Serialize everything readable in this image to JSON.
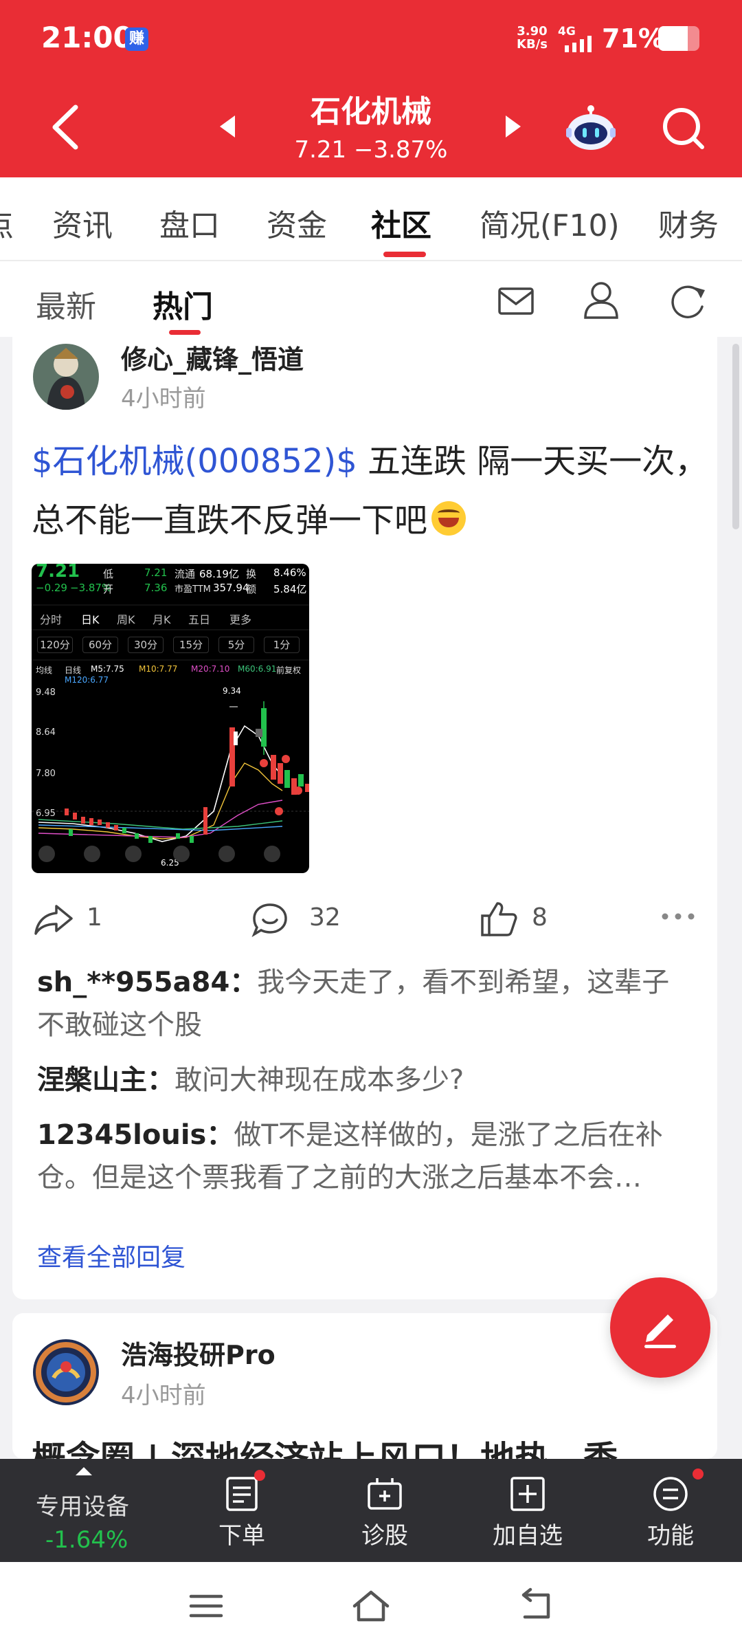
{
  "status": {
    "time": "21:00",
    "app_badge": "赚",
    "net_speed": "3.90",
    "net_unit": "KB/s",
    "network": "4G",
    "battery": "71%",
    "battery_level": 0.71
  },
  "header": {
    "stock_name": "石化机械",
    "quote": "7.21 −3.87%"
  },
  "tabs": [
    {
      "label": "点"
    },
    {
      "label": "资讯"
    },
    {
      "label": "盘口"
    },
    {
      "label": "资金"
    },
    {
      "label": "社区"
    },
    {
      "label": "简况(F10)"
    },
    {
      "label": "财务"
    }
  ],
  "active_tab": "社区",
  "subtabs": [
    {
      "label": "最新"
    },
    {
      "label": "热门"
    }
  ],
  "active_subtab": "热门",
  "post1": {
    "username": "修心_藏锋_悟道",
    "time": "4小时前",
    "stock_tag": "$石化机械(000852)$",
    "text": " 五连跌 隔一天买一次，总不能一直跌不反弹一下吧",
    "emoji": "joy-emoji",
    "thumbnail": {
      "price": "7.21",
      "change": "−0.29",
      "change_pct": "−3.87%",
      "low_label": "低",
      "low_value": "7.21",
      "open_label": "开",
      "open_value": "7.36",
      "float_label": "流通",
      "float_value": "68.19亿",
      "pe_label": "市盈TTM",
      "pe_value": "357.94",
      "turnover_label": "换",
      "turnover_value": "8.46%",
      "amount_label": "额",
      "amount_value": "5.84亿",
      "periods": [
        "分时",
        "日K",
        "周K",
        "月K",
        "五日",
        "更多"
      ],
      "minute_periods": [
        "120分",
        "60分",
        "30分",
        "15分",
        "5分",
        "1分"
      ],
      "ma_type": "均线",
      "ma_labels": [
        "M5:7.75",
        "M10:7.77",
        "M20:7.10",
        "M60:6.91"
      ],
      "ma120": "M120:6.77",
      "day_label": "日线",
      "adjust_label": "前复权",
      "y_ticks": [
        "9.48",
        "8.64",
        "7.80",
        "6.95"
      ],
      "high_mark": "9.34",
      "low_mark": "6.25"
    },
    "share_count": "1",
    "comment_count": "32",
    "like_count": "8",
    "comments": [
      {
        "user": "sh_**955a84：",
        "text": "我今天走了，看不到希望，这辈子不敢碰这个股"
      },
      {
        "user": "涅槃山主：",
        "text": "敢问大神现在成本多少?"
      },
      {
        "user": "12345louis：",
        "text": "做T不是这样做的，是涨了之后在补仓。但是这个票我看了之前的大涨之后基本不会…"
      }
    ],
    "view_all": "查看全部回复"
  },
  "post2": {
    "username": "浩海投研Pro",
    "time": "4小时前",
    "title": "概念圈 | 深地经济站上风口！地热、季"
  },
  "toolbar": {
    "device_label": "专用设备",
    "device_change": "-1.64%",
    "items": [
      {
        "label": "下单"
      },
      {
        "label": "诊股"
      },
      {
        "label": "加自选"
      },
      {
        "label": "功能"
      }
    ]
  },
  "colors": {
    "brand_red": "#e92d35",
    "link_blue": "#2f55d4",
    "down_green": "#22c14d",
    "toolbar_bg": "#2f2f33"
  }
}
